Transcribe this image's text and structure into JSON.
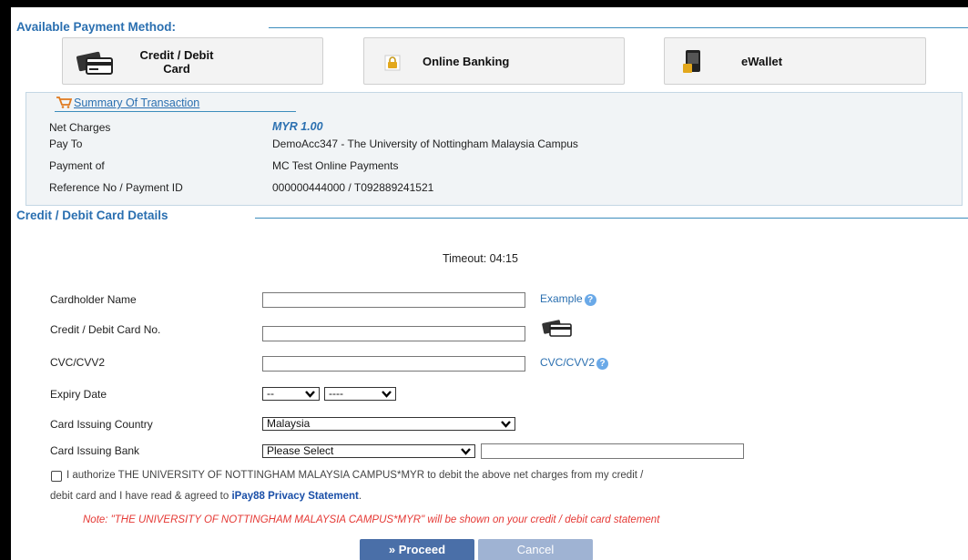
{
  "payment_methods": {
    "title": "Available Payment Method:",
    "credit_debit_line1": "Credit / Debit",
    "credit_debit_line2": "Card",
    "online_banking": "Online Banking",
    "ewallet": "eWallet"
  },
  "summary": {
    "title": "Summary Of Transaction",
    "net_charges_label": "Net Charges",
    "net_charges_value": "MYR 1.00",
    "pay_to_label": "Pay To",
    "pay_to_value": "DemoAcc347 - The University of Nottingham Malaysia Campus",
    "payment_of_label": "Payment of",
    "payment_of_value": "MC Test Online Payments",
    "reference_label": "Reference No / Payment ID",
    "reference_value": "000000444000 / T092889241521"
  },
  "card_details": {
    "title": "Credit / Debit Card Details",
    "timeout": "Timeout: 04:15",
    "cardholder_label": "Cardholder Name",
    "cardholder_value": "",
    "example_link": "Example",
    "card_no_label": "Credit / Debit Card No.",
    "card_no_value": "",
    "cvc_label": "CVC/CVV2",
    "cvc_value": "",
    "cvc_link": "CVC/CVV2",
    "expiry_label": "Expiry Date",
    "expiry_month": "--",
    "expiry_year": "----",
    "country_label": "Card Issuing Country",
    "country_value": "Malaysia",
    "bank_label": "Card Issuing Bank",
    "bank_value": "Please Select",
    "bank_other_value": ""
  },
  "consent": {
    "checked": false,
    "text_line1": "I authorize THE UNIVERSITY OF NOTTINGHAM MALAYSIA CAMPUS*MYR to debit the above net charges from my credit /",
    "text_line2_prefix": "debit card and I have read & agreed to ",
    "privacy_link": "iPay88 Privacy Statement",
    "text_line2_suffix": ".",
    "note": "Note: \"THE UNIVERSITY OF NOTTINGHAM MALAYSIA CAMPUS*MYR\" will be shown on your credit / debit card statement"
  },
  "actions": {
    "proceed": "» Proceed",
    "cancel": "Cancel"
  },
  "colors": {
    "section_title": "#2a6fb0",
    "summary_bg": "#f1f4f6",
    "note_red": "#e53935",
    "proceed_bg": "#4a6fa8",
    "cancel_bg": "#9fb3d3"
  },
  "icons": {
    "credit_card": "credit-card-icon",
    "online_banking": "padlock-icon",
    "ewallet": "wallet-icon",
    "summary": "cart-icon",
    "help": "question-mark-icon"
  }
}
